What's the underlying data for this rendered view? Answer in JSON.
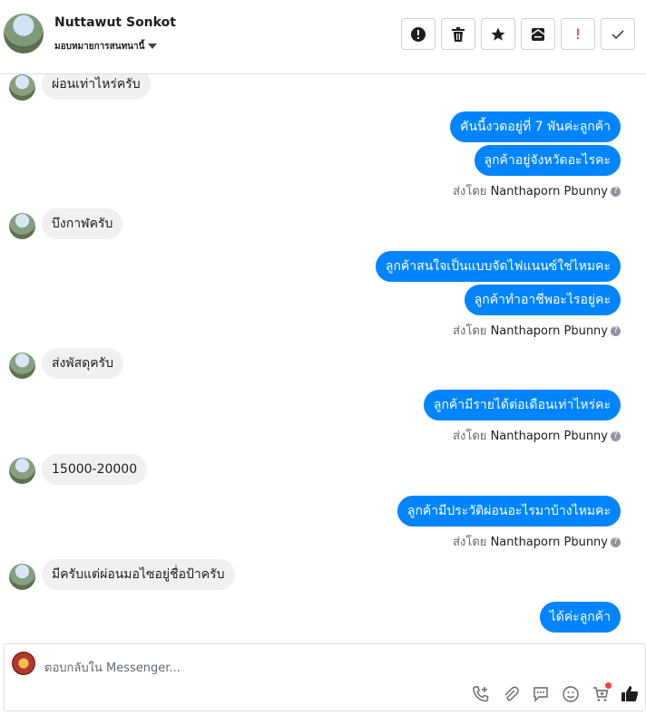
{
  "header": {
    "name": "Nuttawut Sonkot",
    "subtitle": "มอบหมายการสนทนานี้"
  },
  "toolbar": {
    "report_icon": "exclamation-circle-icon",
    "delete_icon": "trash-icon",
    "star_icon": "star-icon",
    "archive_icon": "envelope-archive-icon",
    "important_mark": "!",
    "done_icon": "checkmark-icon"
  },
  "messages": {
    "m1": "ผ่อนเท่าไหร่ครับ",
    "m2": "คันนี้งวดอยู่ที่ 7 พันค่ะลูกค้า",
    "m3": "ลูกค้าอยู่จังหวัดอะไรคะ",
    "m4": "บึงกาฬครับ",
    "m5": "ลูกค้าสนใจเป็นแบบจัดไฟแนนซ์ใช่ไหมคะ",
    "m6": "ลูกค้าทำอาชีพอะไรอยู่คะ",
    "m7": "ส่งพัสดุครับ",
    "m8": "ลูกค้ามีรายได้ต่อเดือนเท่าไหร่คะ",
    "m9": "15000-20000",
    "m10": "ลูกค้ามีประวัติผ่อนอะไรมาบ้างไหมคะ",
    "m11": "มีครับแต่ผ่อนมอไซอยู่ชื่อป้าครับ",
    "m12": "ได้ค่ะลูกค้า"
  },
  "sent_by": {
    "prefix": "ส่งโดย",
    "name": "Nanthaporn Pbunny",
    "help": "?"
  },
  "composer": {
    "placeholder": "ตอบกลับใน Messenger..."
  },
  "colors": {
    "outgoing_bubble": "#0084ff",
    "incoming_bubble": "#f0f0f0",
    "notification_dot": "#fa3e3e",
    "important_red": "#e02020"
  }
}
